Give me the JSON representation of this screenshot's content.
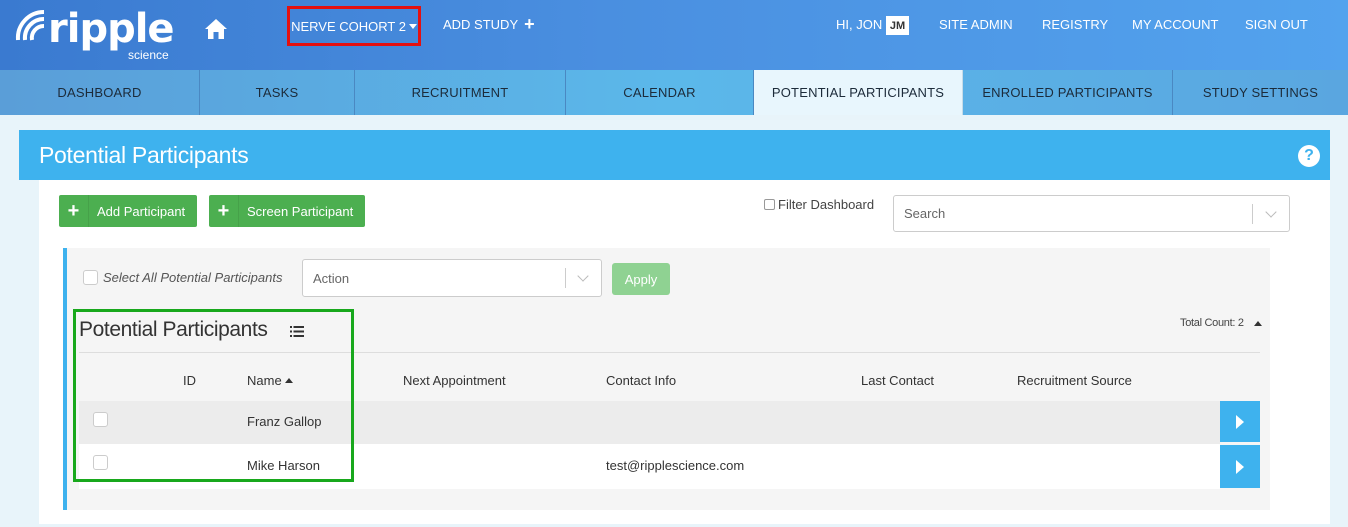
{
  "brand": {
    "word": "ripple",
    "sub": "science"
  },
  "header": {
    "study_selector": "NERVE COHORT 2",
    "add_study": "ADD STUDY",
    "greeting": "HI, JON",
    "avatar_initials": "JM",
    "nav": [
      "SITE ADMIN",
      "REGISTRY",
      "MY ACCOUNT",
      "SIGN OUT"
    ]
  },
  "tabs": [
    {
      "label": "DASHBOARD"
    },
    {
      "label": "TASKS"
    },
    {
      "label": "RECRUITMENT"
    },
    {
      "label": "CALENDAR"
    },
    {
      "label": "POTENTIAL PARTICIPANTS",
      "active": true
    },
    {
      "label": "ENROLLED PARTICIPANTS"
    },
    {
      "label": "STUDY SETTINGS"
    }
  ],
  "panel": {
    "title": "Potential Participants",
    "add_button": "Add Participant",
    "screen_button": "Screen Participant",
    "filter_label": "Filter Dashboard",
    "search_placeholder": "Search"
  },
  "table": {
    "select_all": "Select All Potential Participants",
    "action_placeholder": "Action",
    "apply": "Apply",
    "title": "Potential Participants",
    "total_count": "Total Count: 2",
    "columns": [
      "ID",
      "Name",
      "Next Appointment",
      "Contact Info",
      "Last Contact",
      "Recruitment Source"
    ],
    "rows": [
      {
        "id": "",
        "name": "Franz Gallop",
        "next_appointment": "",
        "contact": "",
        "last_contact": "",
        "source": ""
      },
      {
        "id": "",
        "name": "Mike Harson",
        "next_appointment": "",
        "contact": "test@ripplescience.com",
        "last_contact": "",
        "source": ""
      }
    ]
  },
  "colors": {
    "header_blue": "#3a7ad0",
    "panel_blue": "#3eb2ee",
    "green": "#4caf50",
    "highlight_red": "#e41010",
    "highlight_green": "#18a81c"
  }
}
